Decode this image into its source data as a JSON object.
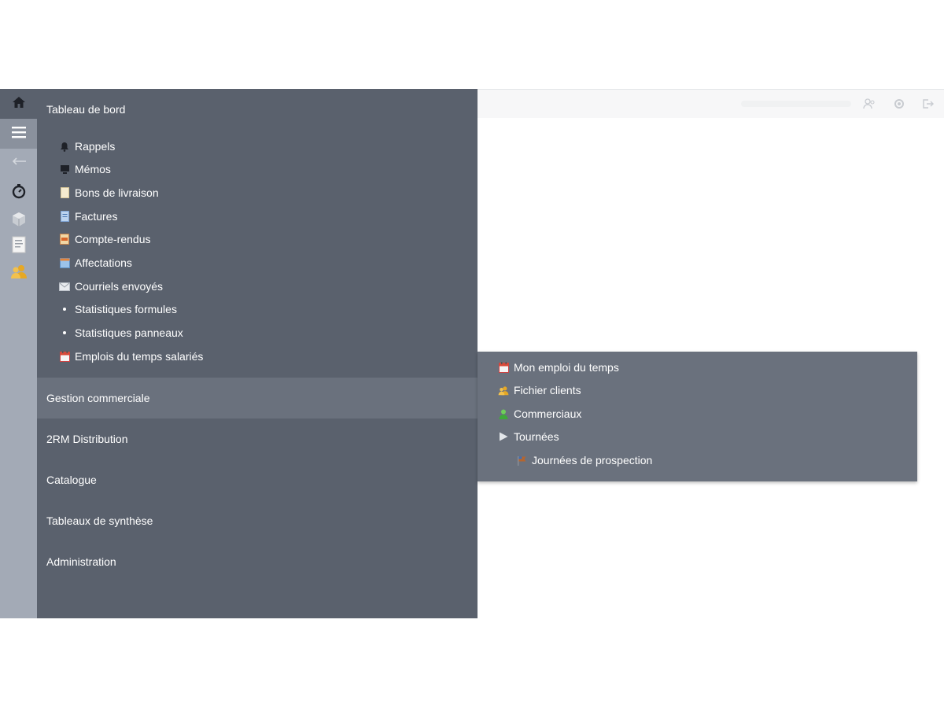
{
  "rail": {
    "items": [
      {
        "icon": "home-icon"
      },
      {
        "icon": "menu-icon"
      },
      {
        "icon": "back-arrow-icon"
      },
      {
        "icon": "timer-icon"
      },
      {
        "icon": "cube-icon"
      },
      {
        "icon": "document-icon"
      },
      {
        "icon": "clients-icon"
      }
    ]
  },
  "menu": {
    "sections": [
      {
        "title": "Tableau de bord",
        "items": [
          {
            "label": "Rappels",
            "icon": "bell-icon"
          },
          {
            "label": "Mémos",
            "icon": "monitor-icon"
          },
          {
            "label": "Bons de livraison",
            "icon": "delivery-note-icon"
          },
          {
            "label": "Factures",
            "icon": "invoice-icon"
          },
          {
            "label": "Compte-rendus",
            "icon": "report-icon"
          },
          {
            "label": "Affectations",
            "icon": "assignment-icon"
          },
          {
            "label": "Courriels envoyés",
            "icon": "mail-icon"
          },
          {
            "label": "Statistiques formules",
            "icon": "bullet-icon"
          },
          {
            "label": "Statistiques panneaux",
            "icon": "bullet-icon"
          },
          {
            "label": "Emplois du temps salariés",
            "icon": "calendar-icon"
          }
        ]
      },
      {
        "title": "Gestion commerciale"
      },
      {
        "title": "2RM Distribution"
      },
      {
        "title": "Catalogue"
      },
      {
        "title": "Tableaux de synthèse"
      },
      {
        "title": "Administration"
      }
    ]
  },
  "flyout": {
    "items": [
      {
        "label": "Mon emploi du temps",
        "icon": "calendar-icon"
      },
      {
        "label": "Fichier clients",
        "icon": "clients-icon"
      },
      {
        "label": "Commerciaux",
        "icon": "salesperson-icon"
      },
      {
        "label": "Tournées",
        "icon": "play-arrow-icon"
      },
      {
        "label": "Journées de prospection",
        "icon": "flag-icon"
      }
    ]
  },
  "colors": {
    "rail_bg": "#a3aab6",
    "panel_bg": "#5a616d",
    "highlight_bg": "#6a717d",
    "text": "#ffffff"
  }
}
